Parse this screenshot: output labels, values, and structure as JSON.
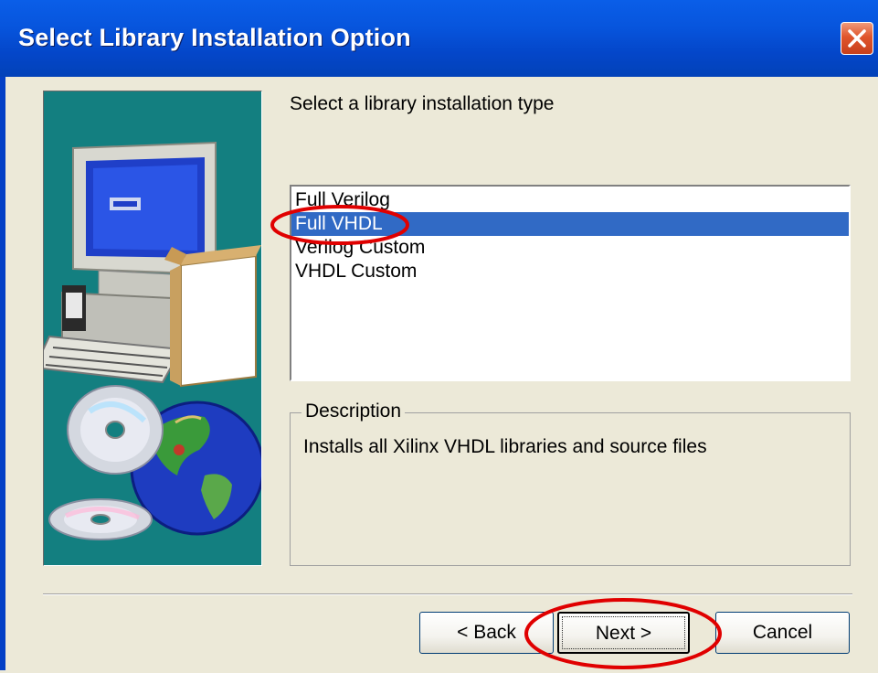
{
  "window": {
    "title": "Select Library Installation Option",
    "close_icon": "close-x-icon"
  },
  "prompt": "Select a library installation type",
  "options": [
    {
      "label": "Full Verilog",
      "selected": false
    },
    {
      "label": "Full VHDL",
      "selected": true
    },
    {
      "label": "Verilog Custom",
      "selected": false
    },
    {
      "label": "VHDL Custom",
      "selected": false
    }
  ],
  "description": {
    "legend": "Description",
    "text": "Installs all Xilinx VHDL libraries and source files"
  },
  "buttons": {
    "back": "< Back",
    "next": "Next >",
    "cancel": "Cancel"
  },
  "colors": {
    "title_bar": "#0555d8",
    "selection": "#316ac5",
    "illustration_bg": "#137f80",
    "annotation": "#e00000"
  }
}
